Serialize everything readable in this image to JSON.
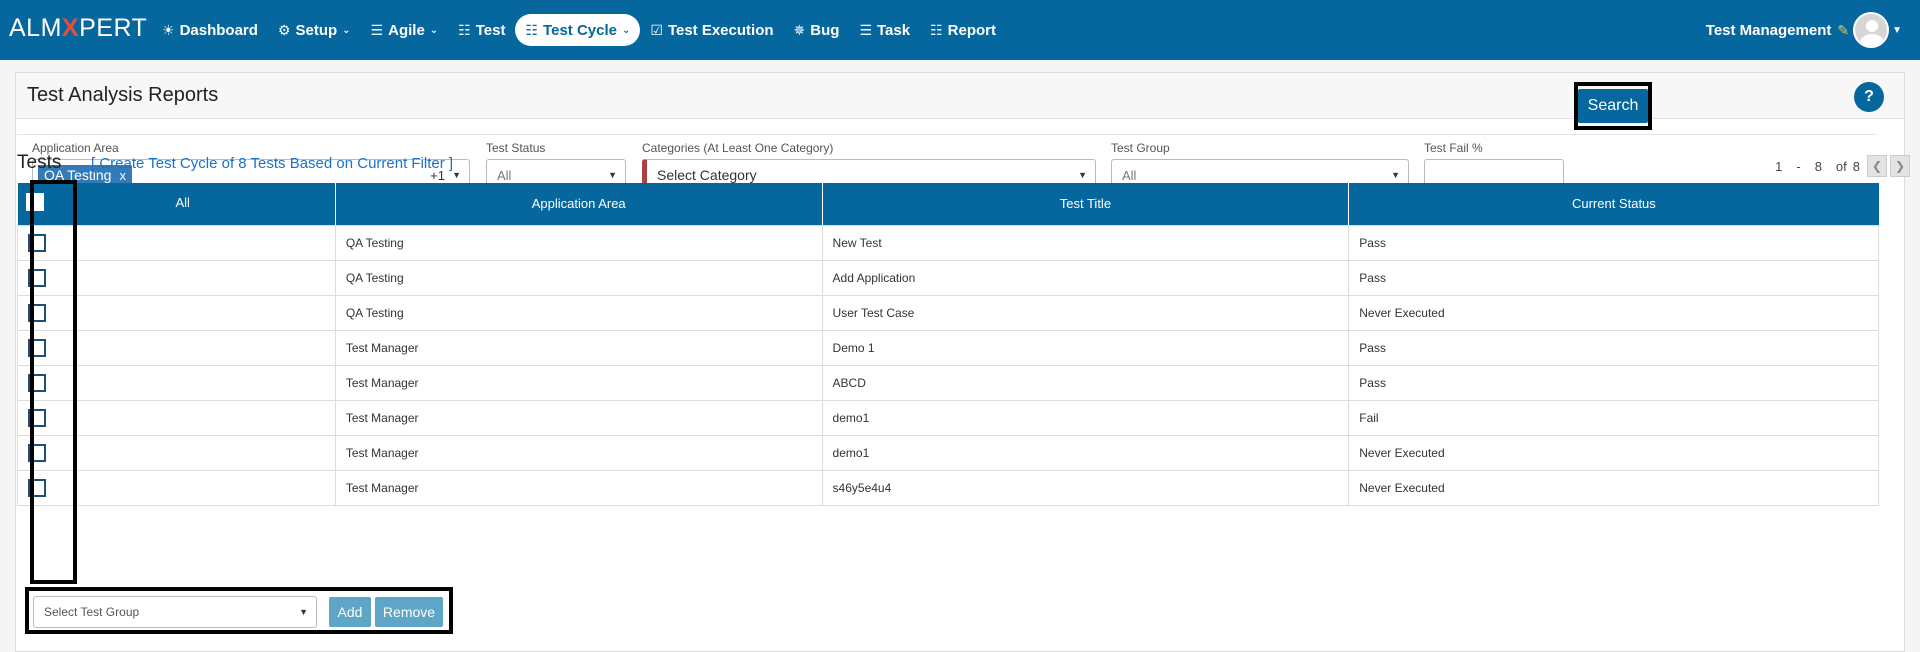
{
  "brand": {
    "prefix": "ALM",
    "x": "X",
    "suffix": "PERT"
  },
  "nav": [
    {
      "icon": "dashboard-icon",
      "glyph": "☀",
      "label": "Dashboard",
      "caret": false,
      "active": false
    },
    {
      "icon": "cogs-icon",
      "glyph": "⚙",
      "label": "Setup",
      "caret": true,
      "active": false
    },
    {
      "icon": "list-icon",
      "glyph": "☰",
      "label": "Agile",
      "caret": true,
      "active": false
    },
    {
      "icon": "document-icon",
      "glyph": "☷",
      "label": "Test",
      "caret": false,
      "active": false
    },
    {
      "icon": "grid-icon",
      "glyph": "☷",
      "label": "Test Cycle",
      "caret": true,
      "active": true
    },
    {
      "icon": "check-square-icon",
      "glyph": "☑",
      "label": "Test Execution",
      "caret": false,
      "active": false
    },
    {
      "icon": "bug-icon",
      "glyph": "✵",
      "label": "Bug",
      "caret": false,
      "active": false
    },
    {
      "icon": "tasks-icon",
      "glyph": "☰",
      "label": "Task",
      "caret": false,
      "active": false
    },
    {
      "icon": "report-icon",
      "glyph": "☷",
      "label": "Report",
      "caret": false,
      "active": false
    }
  ],
  "user": {
    "label": "Test Management"
  },
  "page": {
    "title": "Test Analysis Reports",
    "help": "?"
  },
  "filters": {
    "application_area": {
      "label": "Application Area",
      "tag": "QA Testing",
      "tag_remove": "x",
      "more": "+1"
    },
    "test_status": {
      "label": "Test Status",
      "value": "All"
    },
    "categories": {
      "label": "Categories (At Least One Category)",
      "value": "Select Category"
    },
    "test_group": {
      "label": "Test Group",
      "value": "All"
    },
    "test_fail": {
      "label": "Test Fail %",
      "value": ""
    },
    "search_label": "Search"
  },
  "tests": {
    "title": "Tests",
    "create_link": "[ Create Test Cycle of 8 Tests Based on Current Filter ]",
    "pager": {
      "from": "1",
      "dash": "-",
      "to": "8",
      "of": "of",
      "total": "8"
    },
    "columns": [
      "All",
      "Application Area",
      "Test Title",
      "Current Status"
    ],
    "rows": [
      {
        "area": "QA Testing",
        "title": "New Test",
        "status": "Pass"
      },
      {
        "area": "QA Testing",
        "title": "Add Application",
        "status": "Pass"
      },
      {
        "area": "QA Testing",
        "title": "User Test Case",
        "status": "Never Executed"
      },
      {
        "area": "Test Manager",
        "title": "Demo 1",
        "status": "Pass"
      },
      {
        "area": "Test Manager",
        "title": "ABCD",
        "status": "Pass"
      },
      {
        "area": "Test Manager",
        "title": "demo1",
        "status": "Fail"
      },
      {
        "area": "Test Manager",
        "title": "demo1",
        "status": "Never Executed"
      },
      {
        "area": "Test Manager",
        "title": "s46y5e4u4",
        "status": "Never Executed"
      }
    ]
  },
  "bottom": {
    "select_placeholder": "Select Test Group",
    "add_label": "Add",
    "remove_label": "Remove"
  }
}
